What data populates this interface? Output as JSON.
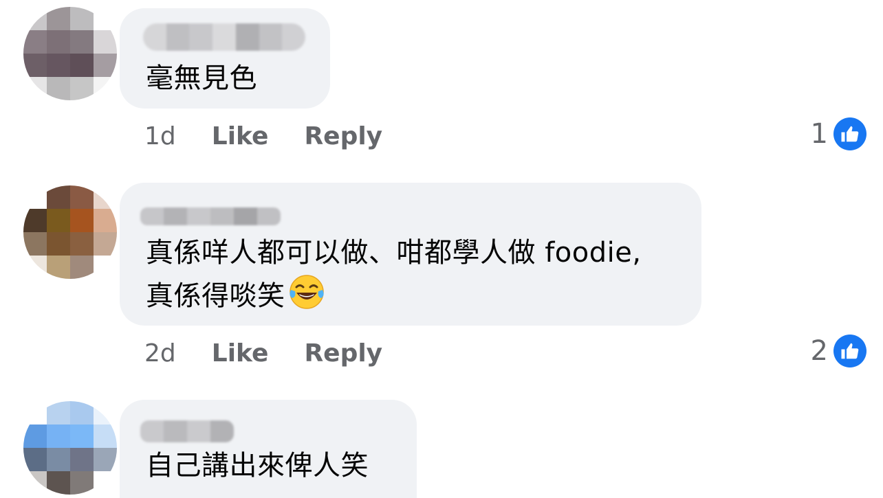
{
  "comments": [
    {
      "text": "毫無見色",
      "time": "1d",
      "like_label": "Like",
      "reply_label": "Reply",
      "reaction_count": "1",
      "reaction_icon": "thumbs-up-icon"
    },
    {
      "text_line1": "真係咩人都可以做、咁都學人做 foodie,",
      "text_line2": "真係得啖笑",
      "emoji": "laughing-tears-emoji",
      "time": "2d",
      "like_label": "Like",
      "reply_label": "Reply",
      "reaction_count": "2",
      "reaction_icon": "thumbs-up-icon"
    },
    {
      "text": "自己講出來俾人笑"
    }
  ],
  "colors": {
    "bubble": "#f0f2f5",
    "meta_text": "#65676b",
    "like_blue": "#1877f2"
  }
}
